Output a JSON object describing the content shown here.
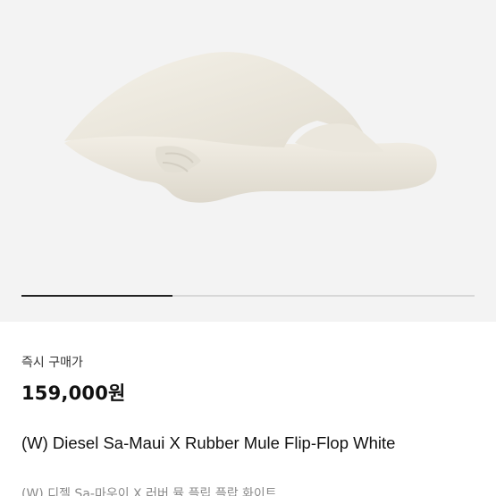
{
  "product": {
    "image_alt": "white rubber flip-flop mule",
    "image_count": 3,
    "current_image_index": 1
  },
  "purchase": {
    "label": "즉시 구매가",
    "price": "159,000원"
  },
  "title": {
    "english": "(W) Diesel Sa-Maui X Rubber Mule Flip-Flop White",
    "korean": "(W) 디젤 Sa-마우이 X 러버 뮬 플립 플랍 화이트"
  },
  "colors": {
    "image_background": "#f3f3f3",
    "sandal": "#efebe1",
    "indicator_active": "#222222",
    "indicator_inactive": "#d7d7d7"
  }
}
